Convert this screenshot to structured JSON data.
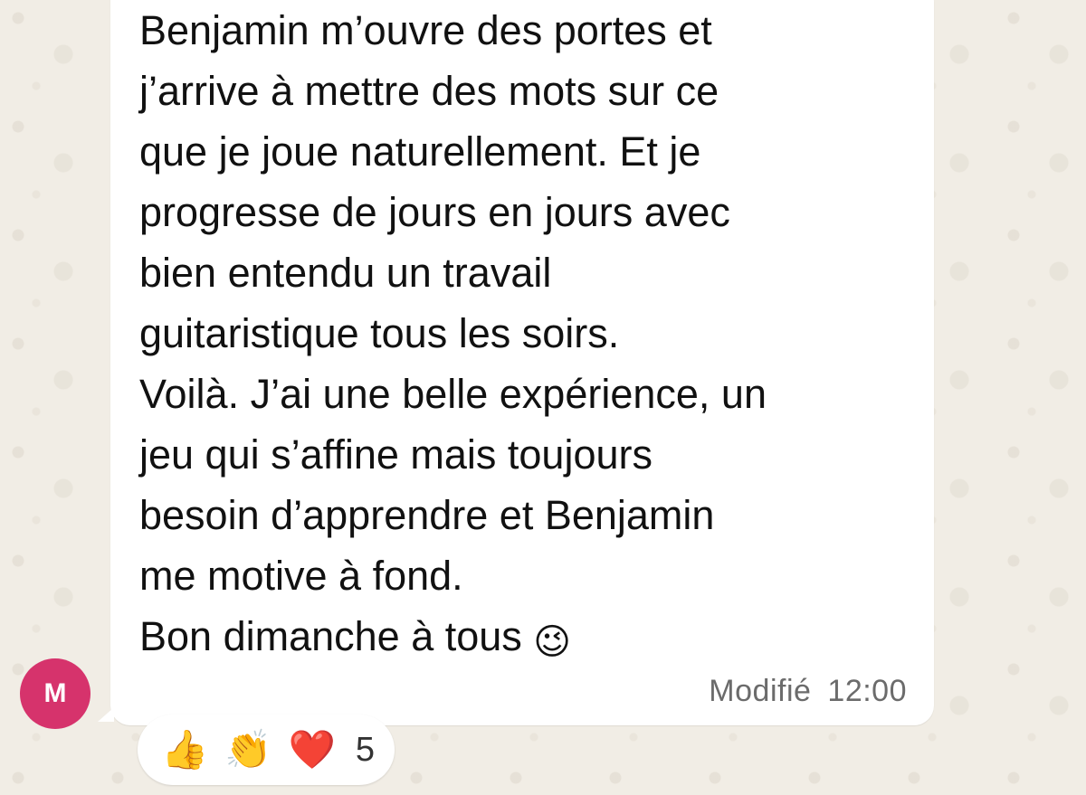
{
  "message": {
    "text": "Benjamin m’ouvre des portes et\nj’arrive à mettre des mots sur ce\nque je joue naturellement. Et je\nprogresse de jours en jours avec\nbien entendu un travail\nguitaristique tous les soirs.\nVoilà. J’ai une belle expérience, un\njeu qui s’affine mais toujours\nbesoin d’apprendre et Benjamin\nme motive à fond.\nBon dimanche à tous ",
    "emoji": "😉",
    "edited_label": "Modifié",
    "time": "12:00"
  },
  "sender": {
    "avatar_initial": "M",
    "avatar_color": "#d6336c"
  },
  "reactions": {
    "items": [
      {
        "name": "thumbs-up",
        "emoji": "👍"
      },
      {
        "name": "clapping-hands",
        "emoji": "👏"
      },
      {
        "name": "red-heart",
        "emoji": "❤️"
      }
    ],
    "count": "5"
  },
  "colors": {
    "chat_background": "#f1ede5",
    "bubble_background": "#ffffff",
    "timestamp": "#6b6b6b"
  }
}
